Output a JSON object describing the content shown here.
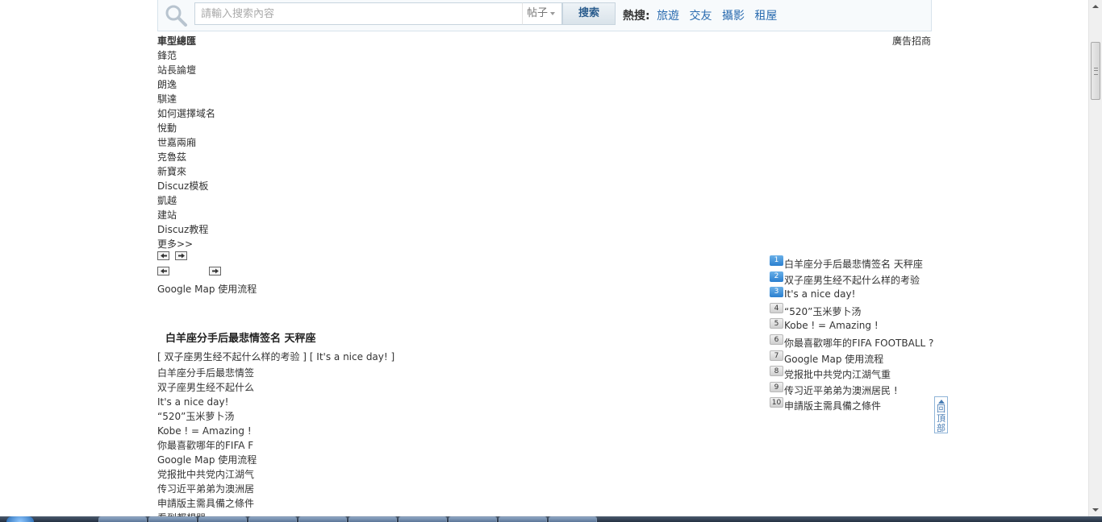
{
  "search": {
    "placeholder": "請輸入搜索內容",
    "type_label": "帖子",
    "button_label": "搜索",
    "hot_label": "熱搜:",
    "hot_links": [
      "旅遊",
      "交友",
      "攝影",
      "租屋"
    ]
  },
  "ad_link": "廣告招商",
  "left_list": [
    "車型總匯",
    "鋒范",
    "站長論壇",
    "朗逸",
    "騏達",
    "如何選擇域名",
    "悅動",
    "世嘉兩廂",
    "克魯茲",
    "新寶來",
    "Discuz模板",
    "凱越",
    "建站",
    "Discuz教程",
    "更多>>"
  ],
  "gmap_line": "Google Map 使用流程",
  "article": {
    "title": "白羊座分手后最悲情签名 天秤座",
    "related": "[ 双子座男生经不起什么样的考验 ] [ It's a nice day! ]",
    "short_list": [
      "白羊座分手后最悲情签",
      "双子座男生经不起什么",
      "It's a nice day!",
      "“520”玉米萝卜汤",
      "Kobe ! = Amazing !",
      "你最喜歡哪年的FIFA F",
      "Google Map 使用流程",
      "党报批中共党内江湖气",
      "传习近平弟弟为澳洲居",
      "申請版主需具備之條件",
      "看到都想哭"
    ]
  },
  "rank_list": [
    {
      "num": "1",
      "text": "白羊座分手后最悲情签名 天秤座"
    },
    {
      "num": "2",
      "text": "双子座男生经不起什么样的考验"
    },
    {
      "num": "3",
      "text": "It's a nice day!"
    },
    {
      "num": "4",
      "text": "“520”玉米萝卜汤"
    },
    {
      "num": "5",
      "text": "Kobe ! = Amazing !"
    },
    {
      "num": "6",
      "text": "你最喜歡哪年的FIFA FOOTBALL ?"
    },
    {
      "num": "7",
      "text": "Google Map 使用流程"
    },
    {
      "num": "8",
      "text": "党报批中共党内江湖气重"
    },
    {
      "num": "9",
      "text": "传习近平弟弟为澳洲居民 !"
    },
    {
      "num": "10",
      "text": "申請版主需具備之條件"
    }
  ],
  "back_to_top": {
    "line1": "回",
    "line2": "頂",
    "line3": "部"
  },
  "colors": {
    "link_blue": "#2b6cb0",
    "rank_top": "#2a7fcf"
  }
}
